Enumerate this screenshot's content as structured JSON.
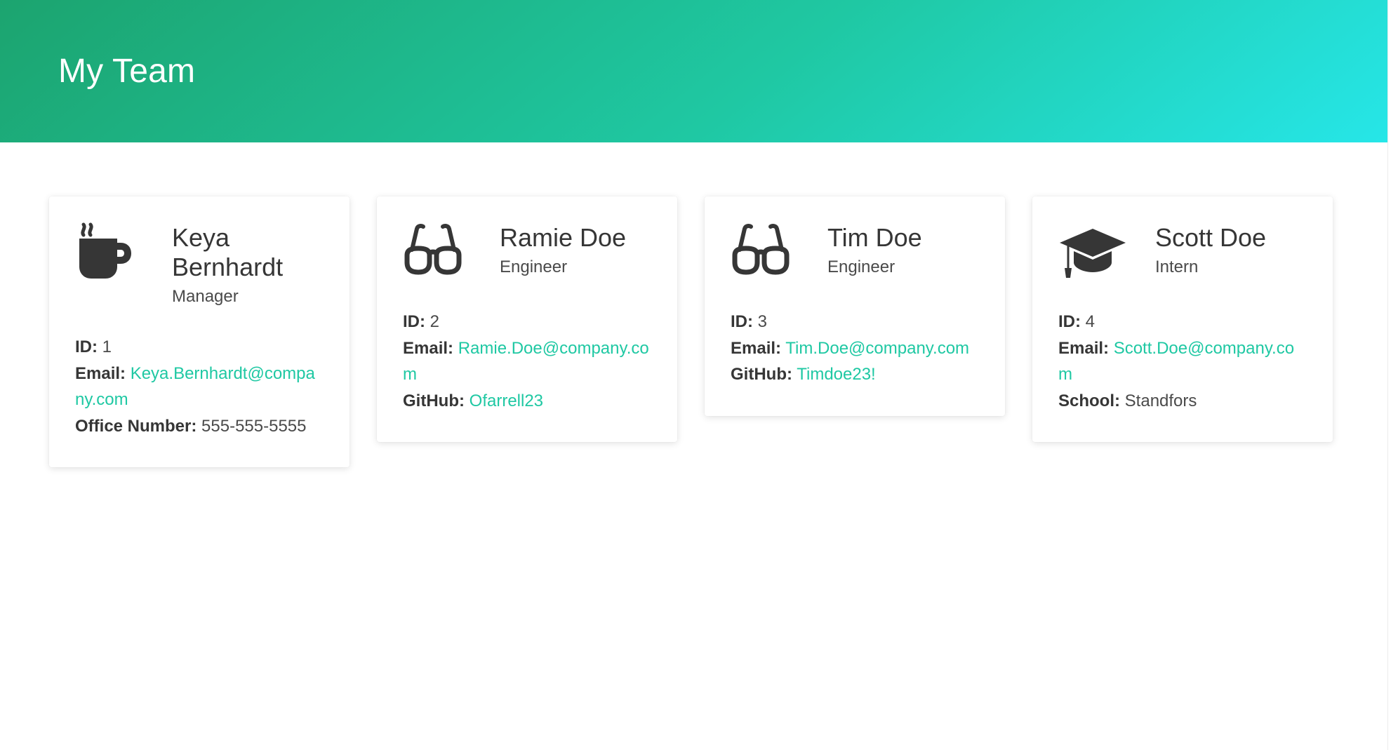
{
  "hero": {
    "title": "My Team"
  },
  "colors": {
    "gradient_start": "#1ca46f",
    "gradient_end": "#26e6e8",
    "link": "#1fc8a3",
    "text": "#363636"
  },
  "team": [
    {
      "icon": "coffee-mug-icon",
      "name": "Keya Bernhardt",
      "role": "Manager",
      "id_label": "ID:",
      "id_value": "1",
      "email_label": "Email:",
      "email_value": "Keya.Bernhardt@company.com",
      "extra_label": "Office Number:",
      "extra_value": "555-555-5555"
    },
    {
      "icon": "glasses-icon",
      "name": "Ramie Doe",
      "role": "Engineer",
      "id_label": "ID:",
      "id_value": "2",
      "email_label": "Email:",
      "email_value": "Ramie.Doe@company.com",
      "extra_label": "GitHub:",
      "extra_value": "Ofarrell23"
    },
    {
      "icon": "glasses-icon",
      "name": "Tim Doe",
      "role": "Engineer",
      "id_label": "ID:",
      "id_value": "3",
      "email_label": "Email:",
      "email_value": "Tim.Doe@company.com",
      "extra_label": "GitHub:",
      "extra_value": "Timdoe23!"
    },
    {
      "icon": "graduation-cap-icon",
      "name": "Scott Doe",
      "role": "Intern",
      "id_label": "ID:",
      "id_value": "4",
      "email_label": "Email:",
      "email_value": "Scott.Doe@company.com",
      "extra_label": "School:",
      "extra_value": "Standfors"
    }
  ]
}
